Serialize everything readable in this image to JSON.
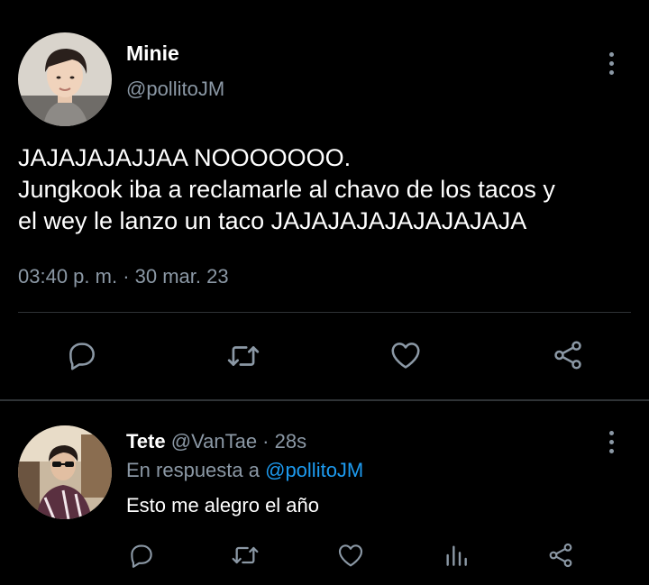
{
  "tweet": {
    "author_name": "Minie",
    "author_handle": "@pollitoJM",
    "text_lines": [
      "JAJAJAJAJJAA NOOOOOOO.",
      "Jungkook iba a reclamarle al chavo de los tacos y",
      "el wey le lanzo un taco JAJAJAJAJAJAJAJAJA"
    ],
    "time": "03:40 p. m.",
    "separator": " · ",
    "date": "30 mar. 23",
    "actions": [
      "reply-icon",
      "retweet-icon",
      "like-icon",
      "share-icon"
    ]
  },
  "reply": {
    "author_name": "Tete",
    "author_handle": "@VanTae",
    "dot": " · ",
    "age": "28s",
    "replying_to_prefix": "En respuesta a ",
    "replying_to_handle": "@pollitoJM",
    "text": "Esto me alegro el año",
    "actions": [
      "reply-icon",
      "retweet-icon",
      "like-icon",
      "analytics-icon",
      "share-icon"
    ]
  },
  "colors": {
    "background": "#000000",
    "text": "#ffffff",
    "secondary": "#8b98a5",
    "link": "#1d9bf0",
    "divider": "#2f3336"
  }
}
